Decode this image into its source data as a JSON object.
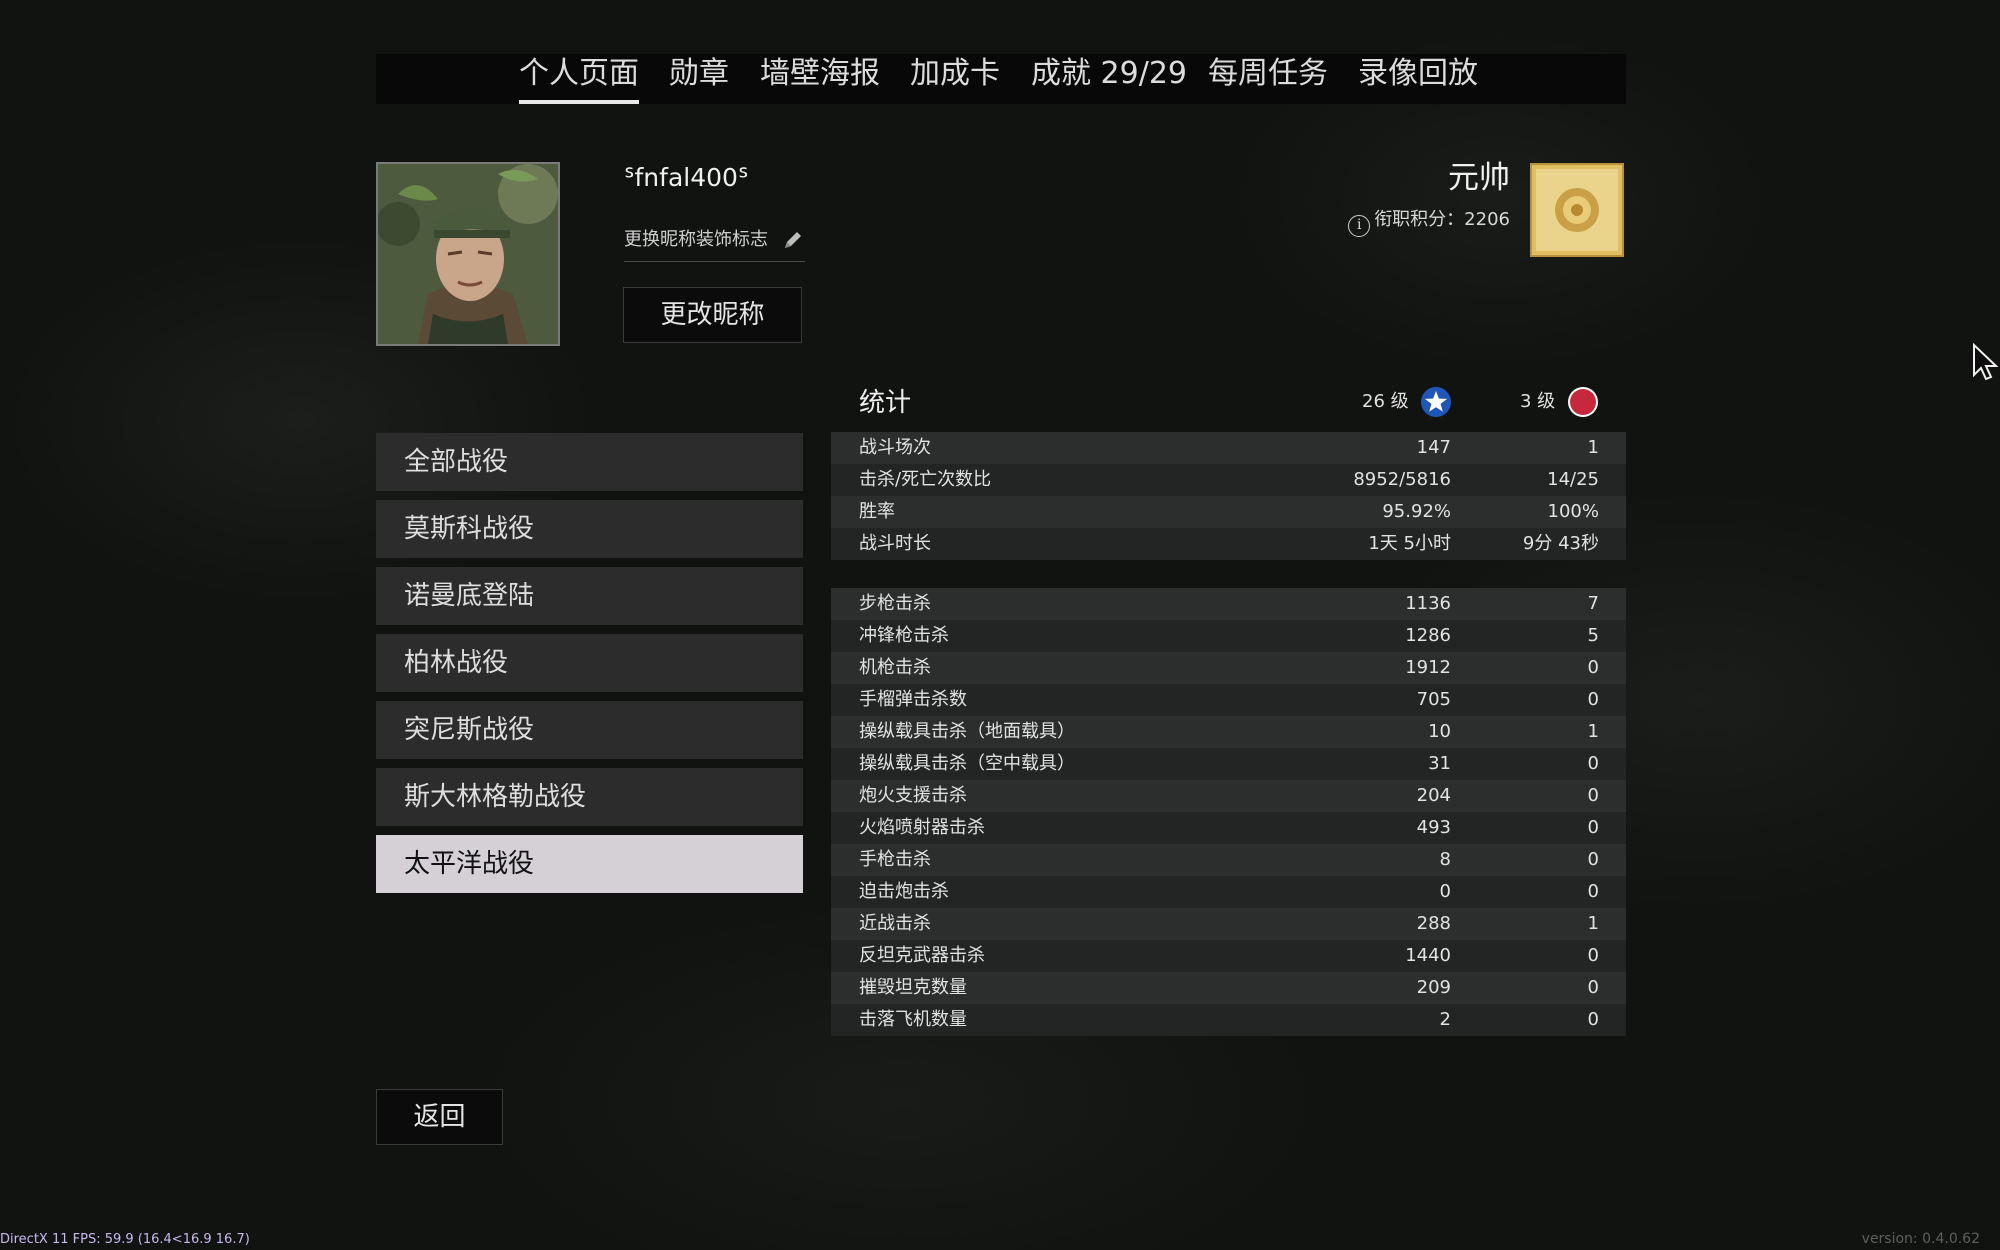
{
  "tabs": [
    {
      "label": "个人页面",
      "active": true
    },
    {
      "label": "勋章",
      "active": false
    },
    {
      "label": "墙壁海报",
      "active": false
    },
    {
      "label": "加成卡",
      "active": false
    },
    {
      "label": "成就 29/29",
      "active": false
    },
    {
      "label": "每周任务",
      "active": false
    },
    {
      "label": "录像回放",
      "active": false
    }
  ],
  "profile": {
    "nickname": "ᔆfnfal400ᔆ",
    "nickname_decoration_label": "更换昵称装饰标志",
    "rename_button": "更改昵称",
    "rank_title": "元帅",
    "rank_points_label": "衔职积分：2206"
  },
  "campaigns": [
    {
      "label": "全部战役",
      "active": false
    },
    {
      "label": "莫斯科战役",
      "active": false
    },
    {
      "label": "诺曼底登陆",
      "active": false
    },
    {
      "label": "柏林战役",
      "active": false
    },
    {
      "label": "突尼斯战役",
      "active": false
    },
    {
      "label": "斯大林格勒战役",
      "active": false
    },
    {
      "label": "太平洋战役",
      "active": true
    }
  ],
  "back_button": "返回",
  "stats": {
    "title": "统计",
    "level_col1": "26 级",
    "level_col2": "3 级",
    "summary": [
      {
        "label": "战斗场次",
        "v1": "147",
        "v2": "1"
      },
      {
        "label": "击杀/死亡次数比",
        "v1": "8952/5816",
        "v2": "14/25"
      },
      {
        "label": "胜率",
        "v1": "95.92%",
        "v2": "100%"
      },
      {
        "label": "战斗时长",
        "v1": "1天 5小时",
        "v2": "9分 43秒"
      }
    ],
    "kills": [
      {
        "label": "步枪击杀",
        "v1": "1136",
        "v2": "7"
      },
      {
        "label": "冲锋枪击杀",
        "v1": "1286",
        "v2": "5"
      },
      {
        "label": "机枪击杀",
        "v1": "1912",
        "v2": "0"
      },
      {
        "label": "手榴弹击杀数",
        "v1": "705",
        "v2": "0"
      },
      {
        "label": "操纵载具击杀（地面载具）",
        "v1": "10",
        "v2": "1"
      },
      {
        "label": "操纵载具击杀（空中载具）",
        "v1": "31",
        "v2": "0"
      },
      {
        "label": "炮火支援击杀",
        "v1": "204",
        "v2": "0"
      },
      {
        "label": "火焰喷射器击杀",
        "v1": "493",
        "v2": "0"
      },
      {
        "label": "手枪击杀",
        "v1": "8",
        "v2": "0"
      },
      {
        "label": "迫击炮击杀",
        "v1": "0",
        "v2": "0"
      },
      {
        "label": "近战击杀",
        "v1": "288",
        "v2": "1"
      },
      {
        "label": "反坦克武器击杀",
        "v1": "1440",
        "v2": "0"
      },
      {
        "label": "摧毁坦克数量",
        "v1": "209",
        "v2": "0"
      },
      {
        "label": "击落飞机数量",
        "v1": "2",
        "v2": "0"
      }
    ]
  },
  "footer": {
    "fps": "DirectX 11 FPS: 59.9 (16.4<16.9 16.7)",
    "version": "version: 0.4.0.62"
  },
  "colors": {
    "background": "#111311",
    "active_campaign": "#d4d0d6",
    "allies_star_badge": "#1f56b8",
    "axis_badge": "#c8283c",
    "rank_badge_gold": "#d9b65a"
  }
}
